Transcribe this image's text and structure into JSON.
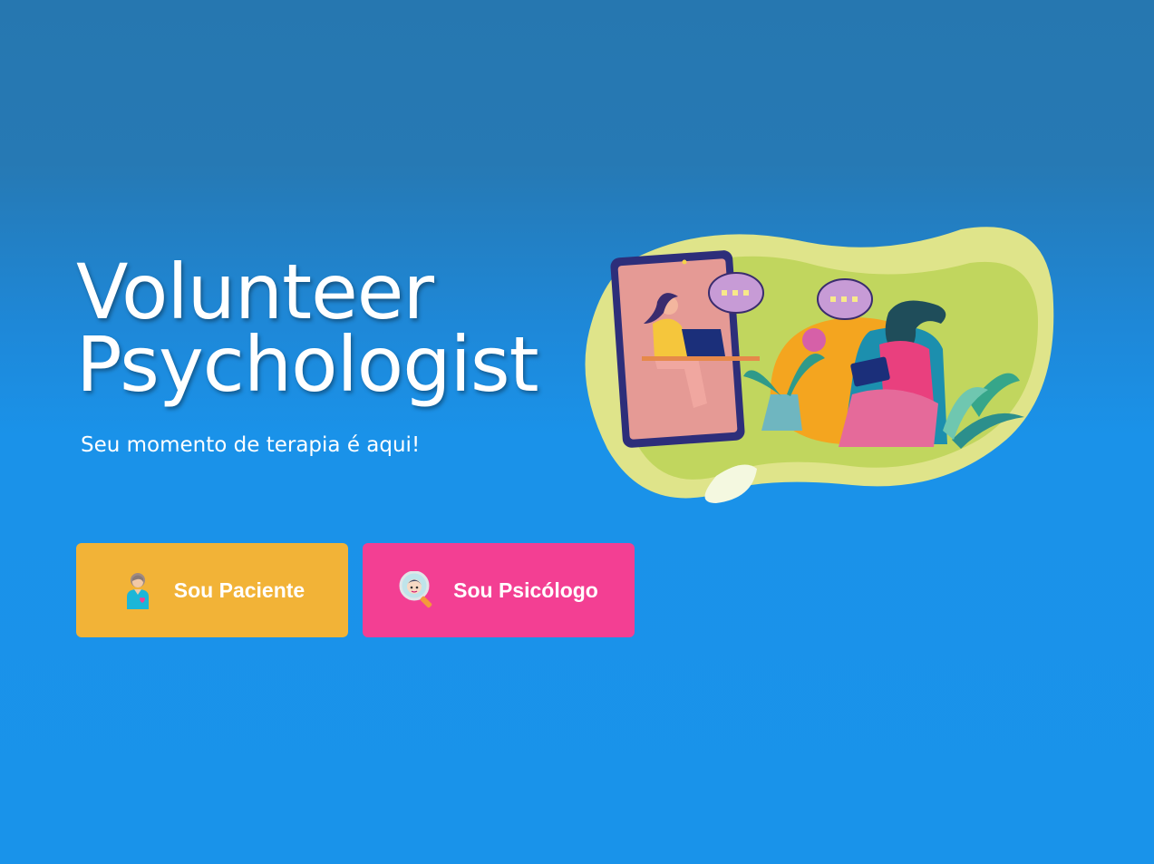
{
  "hero": {
    "title_line1": "Volunteer",
    "title_line2": "Psychologist",
    "subtitle": "Seu momento de terapia é aqui!"
  },
  "buttons": {
    "patient": {
      "label": "Sou Paciente",
      "icon": "patient-icon",
      "color": "#f2b337"
    },
    "psychologist": {
      "label": "Sou Psicólogo",
      "icon": "psychologist-icon",
      "color": "#f33f93"
    }
  },
  "illustration": {
    "icon": "online-therapy-illustration"
  },
  "colors": {
    "background_top": "#2677b0",
    "background_bottom": "#1993ea"
  }
}
